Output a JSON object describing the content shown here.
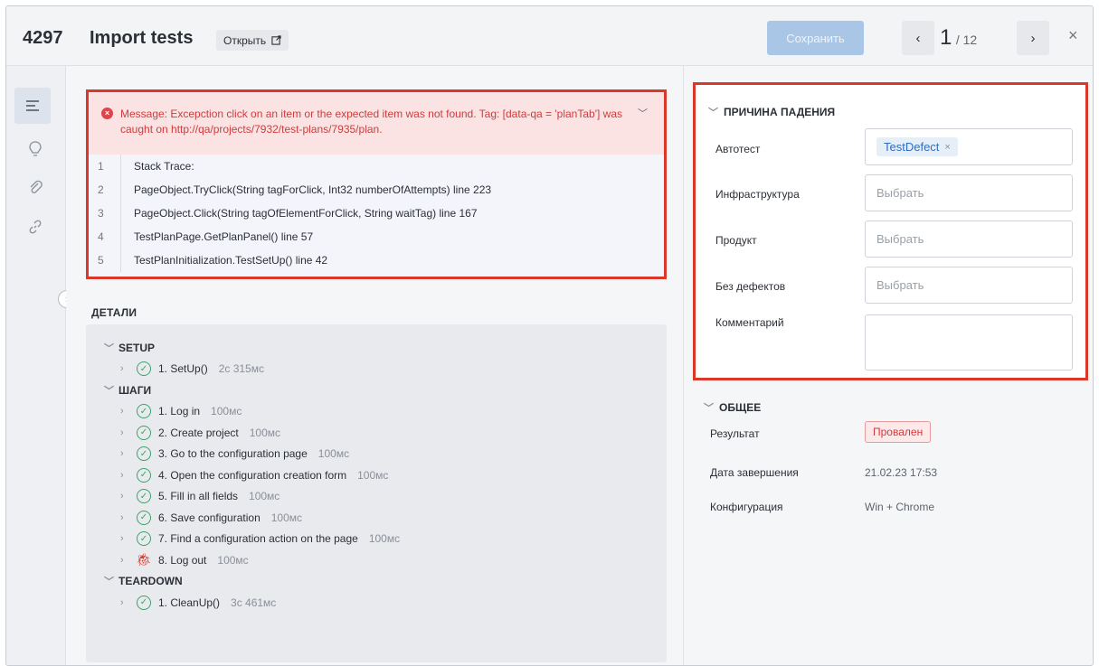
{
  "header": {
    "test_id": "4297",
    "title": "Import tests",
    "open_label": "Открыть",
    "save_label": "Сохранить",
    "prev_glyph": "‹",
    "next_glyph": "›",
    "page_current": "1",
    "page_total": "/ 12",
    "close_glyph": "×"
  },
  "error": {
    "message": "Message: Excepction click on an item or the expected item was not found. Tag: [data-qa = 'planTab'] was caught on http://qa/projects/7932/test-plans/7935/plan.",
    "trace": [
      {
        "n": "1",
        "text": "Stack Trace:"
      },
      {
        "n": "2",
        "text": "PageObject.TryClick(String tagForClick, Int32 numberOfAttempts) line 223"
      },
      {
        "n": "3",
        "text": "PageObject.Click(String tagOfElementForClick, String waitTag) line 167"
      },
      {
        "n": "4",
        "text": "TestPlanPage.GetPlanPanel() line 57"
      },
      {
        "n": "5",
        "text": "TestPlanInitialization.TestSetUp() line 42"
      }
    ]
  },
  "details": {
    "title": "ДЕТАЛИ",
    "setup_label": "SETUP",
    "setup_steps": [
      {
        "label": "1. SetUp()",
        "dur": "2с 315мс"
      }
    ],
    "steps_label": "ШАГИ",
    "steps": [
      {
        "label": "1. Log in",
        "dur": "100мс"
      },
      {
        "label": "2. Create project",
        "dur": "100мс"
      },
      {
        "label": "3. Go to the configuration page",
        "dur": "100мс"
      },
      {
        "label": "4. Open the configuration creation form",
        "dur": "100мс"
      },
      {
        "label": "5. Fill in all fields",
        "dur": "100мс"
      },
      {
        "label": "6. Save configuration",
        "dur": "100мс"
      },
      {
        "label": "7. Find a configuration action on the page",
        "dur": "100мс"
      },
      {
        "label": "8. Log out",
        "dur": "100мс"
      }
    ],
    "teardown_label": "TEARDOWN",
    "teardown_steps": [
      {
        "label": "1. CleanUp()",
        "dur": "3с 461мс"
      }
    ]
  },
  "failure": {
    "title": "ПРИЧИНА ПАДЕНИЯ",
    "autotest_label": "Автотест",
    "autotest_tag": "TestDefect",
    "infra_label": "Инфраструктура",
    "product_label": "Продукт",
    "nodefect_label": "Без дефектов",
    "comment_label": "Комментарий",
    "select_placeholder": "Выбрать"
  },
  "general": {
    "title": "ОБЩЕЕ",
    "result_label": "Результат",
    "result_value": "Провален",
    "date_label": "Дата завершения",
    "date_value": "21.02.23 17:53",
    "config_label": "Конфигурация",
    "config_value": "Win + Chrome"
  },
  "colors": {
    "accent": "#2f6fbd",
    "error_red": "#d9382a",
    "success_green": "#3aa36a"
  }
}
